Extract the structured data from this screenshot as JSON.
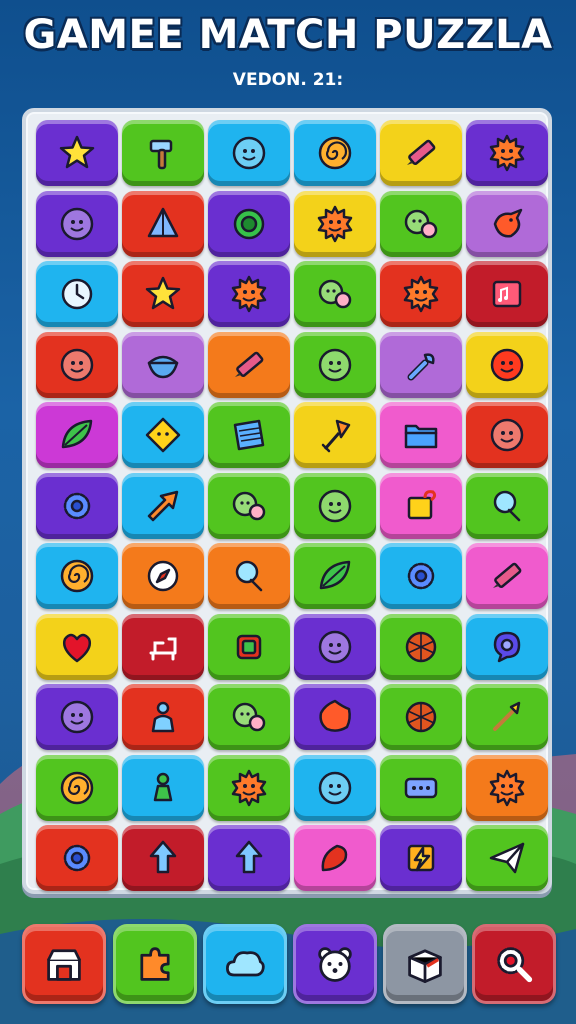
{
  "header": {
    "title": "GAMEE MATCH PUZZLA",
    "version": "VEDON. 21:"
  },
  "colors": {
    "purple": "#6a2fd0",
    "green": "#52c51f",
    "cyan": "#1fb4ef",
    "yellow": "#f3d21a",
    "red": "#e3321f",
    "orange": "#f47a1b",
    "lilac": "#b06ad8",
    "magenta": "#cc39d6",
    "pink": "#f05bcd",
    "crimson": "#c21c2a",
    "gray": "#8d96a3"
  },
  "board": {
    "rows": [
      [
        {
          "color": "purple",
          "icon": "star-icon"
        },
        {
          "color": "green",
          "icon": "hammer-icon"
        },
        {
          "color": "cyan",
          "icon": "smiley-face-icon"
        },
        {
          "color": "cyan",
          "icon": "spiral-icon"
        },
        {
          "color": "yellow",
          "icon": "pencil-icon"
        },
        {
          "color": "purple",
          "icon": "sun-face-icon"
        }
      ],
      [
        {
          "color": "purple",
          "icon": "smiley-face-icon"
        },
        {
          "color": "red",
          "icon": "pyramid-icon"
        },
        {
          "color": "purple",
          "icon": "ring-icon"
        },
        {
          "color": "yellow",
          "icon": "sun-face-icon"
        },
        {
          "color": "green",
          "icon": "twin-faces-icon"
        },
        {
          "color": "lilac",
          "icon": "bird-icon"
        }
      ],
      [
        {
          "color": "cyan",
          "icon": "clock-icon"
        },
        {
          "color": "red",
          "icon": "star-icon"
        },
        {
          "color": "purple",
          "icon": "sun-face-icon"
        },
        {
          "color": "green",
          "icon": "twin-faces-icon"
        },
        {
          "color": "red",
          "icon": "sun-face-icon"
        },
        {
          "color": "crimson",
          "icon": "music-card-icon"
        }
      ],
      [
        {
          "color": "red",
          "icon": "smiley-face-icon"
        },
        {
          "color": "lilac",
          "icon": "bowl-icon"
        },
        {
          "color": "orange",
          "icon": "pencil-icon"
        },
        {
          "color": "green",
          "icon": "smiley-face-icon"
        },
        {
          "color": "lilac",
          "icon": "wrench-icon"
        },
        {
          "color": "yellow",
          "icon": "red-face-icon"
        }
      ],
      [
        {
          "color": "magenta",
          "icon": "leaf-icon"
        },
        {
          "color": "cyan",
          "icon": "diamond-face-icon"
        },
        {
          "color": "green",
          "icon": "book-icon"
        },
        {
          "color": "yellow",
          "icon": "shovel-icon"
        },
        {
          "color": "pink",
          "icon": "folder-icon"
        },
        {
          "color": "red",
          "icon": "smiley-face-icon"
        }
      ],
      [
        {
          "color": "purple",
          "icon": "gear-icon"
        },
        {
          "color": "cyan",
          "icon": "arrow-icon"
        },
        {
          "color": "green",
          "icon": "twin-faces-icon"
        },
        {
          "color": "green",
          "icon": "smiley-face-icon"
        },
        {
          "color": "pink",
          "icon": "tag-icon"
        },
        {
          "color": "green",
          "icon": "balloon-icon"
        }
      ],
      [
        {
          "color": "cyan",
          "icon": "spiral-icon"
        },
        {
          "color": "orange",
          "icon": "compass-icon"
        },
        {
          "color": "orange",
          "icon": "balloon-icon"
        },
        {
          "color": "green",
          "icon": "leaf-icon"
        },
        {
          "color": "cyan",
          "icon": "gear-icon"
        },
        {
          "color": "pink",
          "icon": "pencil-icon"
        }
      ],
      [
        {
          "color": "yellow",
          "icon": "heart-icon"
        },
        {
          "color": "crimson",
          "icon": "bench-icon"
        },
        {
          "color": "green",
          "icon": "square-icon"
        },
        {
          "color": "purple",
          "icon": "smiley-face-icon"
        },
        {
          "color": "green",
          "icon": "shell-icon"
        },
        {
          "color": "cyan",
          "icon": "chat-bubble-icon"
        }
      ],
      [
        {
          "color": "purple",
          "icon": "smiley-face-icon"
        },
        {
          "color": "red",
          "icon": "person-icon"
        },
        {
          "color": "green",
          "icon": "twin-faces-icon"
        },
        {
          "color": "purple",
          "icon": "blob-icon"
        },
        {
          "color": "green",
          "icon": "shell-icon"
        },
        {
          "color": "green",
          "icon": "brush-icon"
        }
      ],
      [
        {
          "color": "green",
          "icon": "spiral-icon"
        },
        {
          "color": "cyan",
          "icon": "pawn-icon"
        },
        {
          "color": "green",
          "icon": "sun-face-icon"
        },
        {
          "color": "cyan",
          "icon": "smiley-face-icon"
        },
        {
          "color": "green",
          "icon": "dice-icon"
        },
        {
          "color": "orange",
          "icon": "sun-face-icon"
        }
      ],
      [
        {
          "color": "red",
          "icon": "gear-icon"
        },
        {
          "color": "crimson",
          "icon": "arrow-up-icon"
        },
        {
          "color": "purple",
          "icon": "arrow-up-icon"
        },
        {
          "color": "pink",
          "icon": "carrot-icon"
        },
        {
          "color": "purple",
          "icon": "lightning-card-icon"
        },
        {
          "color": "green",
          "icon": "paper-plane-icon"
        }
      ]
    ]
  },
  "toolbar": {
    "buttons": [
      {
        "color": "red",
        "icon": "shop-icon"
      },
      {
        "color": "green",
        "icon": "puzzle-icon"
      },
      {
        "color": "cyan",
        "icon": "cloud-icon"
      },
      {
        "color": "purple",
        "icon": "bear-icon"
      },
      {
        "color": "gray",
        "icon": "box-icon"
      },
      {
        "color": "crimson",
        "icon": "search-gear-icon"
      }
    ]
  }
}
